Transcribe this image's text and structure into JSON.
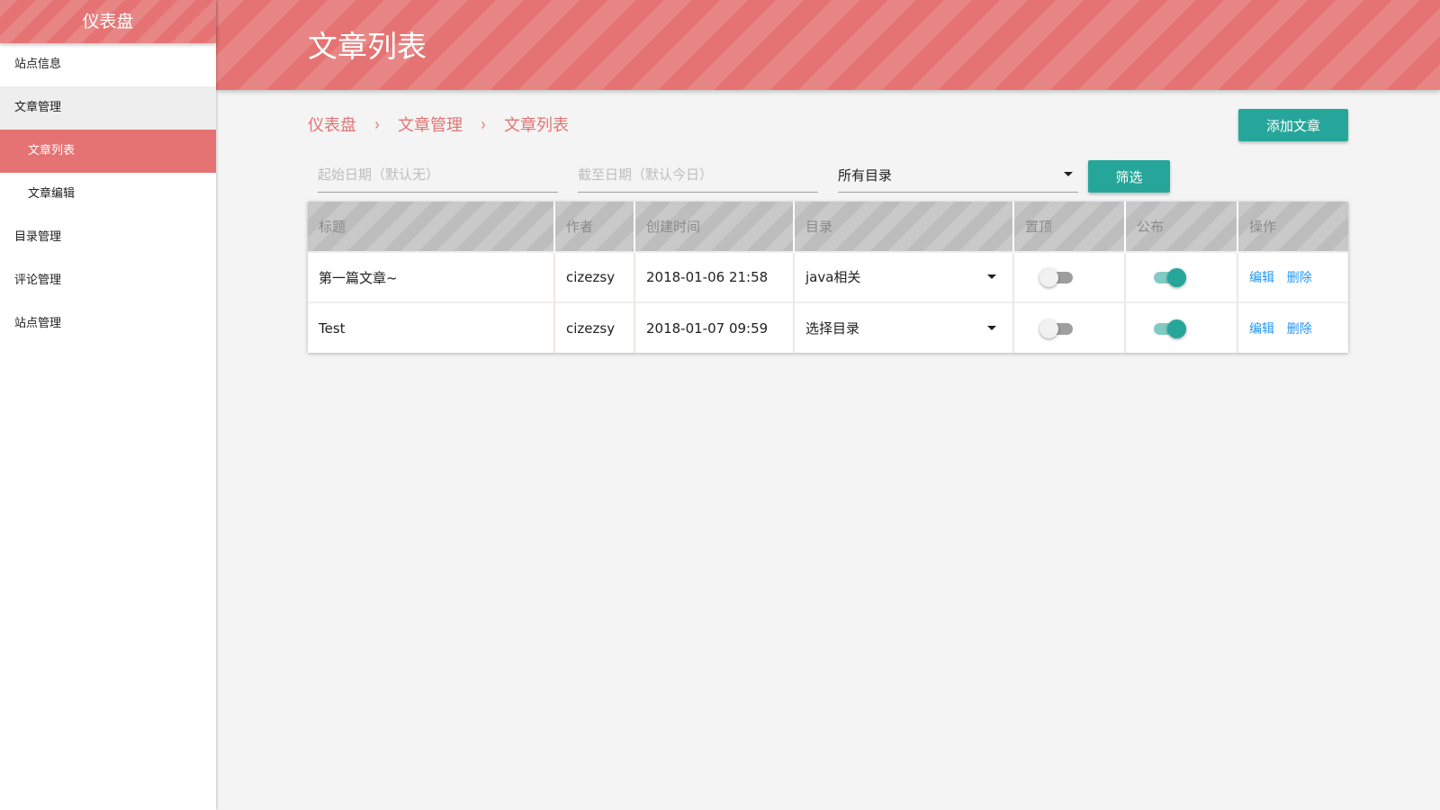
{
  "sidebar": {
    "title": "仪表盘",
    "items": [
      {
        "label": "站点信息"
      },
      {
        "label": "文章管理"
      },
      {
        "label": "文章列表"
      },
      {
        "label": "文章编辑"
      },
      {
        "label": "目录管理"
      },
      {
        "label": "评论管理"
      },
      {
        "label": "站点管理"
      }
    ]
  },
  "header": {
    "title": "文章列表"
  },
  "breadcrumb": {
    "items": [
      "仪表盘",
      "文章管理",
      "文章列表"
    ],
    "separator": "›"
  },
  "actions": {
    "add_label": "添加文章",
    "filter_label": "筛选"
  },
  "filters": {
    "start_placeholder": "起始日期（默认无）",
    "end_placeholder": "截至日期（默认今日）",
    "category_value": "所有目录"
  },
  "table": {
    "headers": [
      "标题",
      "作者",
      "创建时间",
      "目录",
      "置顶",
      "公布",
      "操作"
    ],
    "rows": [
      {
        "title": "第一篇文章~",
        "author": "cizezsy",
        "created": "2018-01-06 21:58",
        "category": "java相关",
        "pinned": false,
        "published": true
      },
      {
        "title": "Test",
        "author": "cizezsy",
        "created": "2018-01-07 09:59",
        "category": "选择目录",
        "pinned": false,
        "published": true
      }
    ],
    "edit_label": "编辑",
    "delete_label": "删除"
  },
  "colors": {
    "primary": "#e57373",
    "accent": "#26a69a",
    "link": "#2196f3"
  }
}
